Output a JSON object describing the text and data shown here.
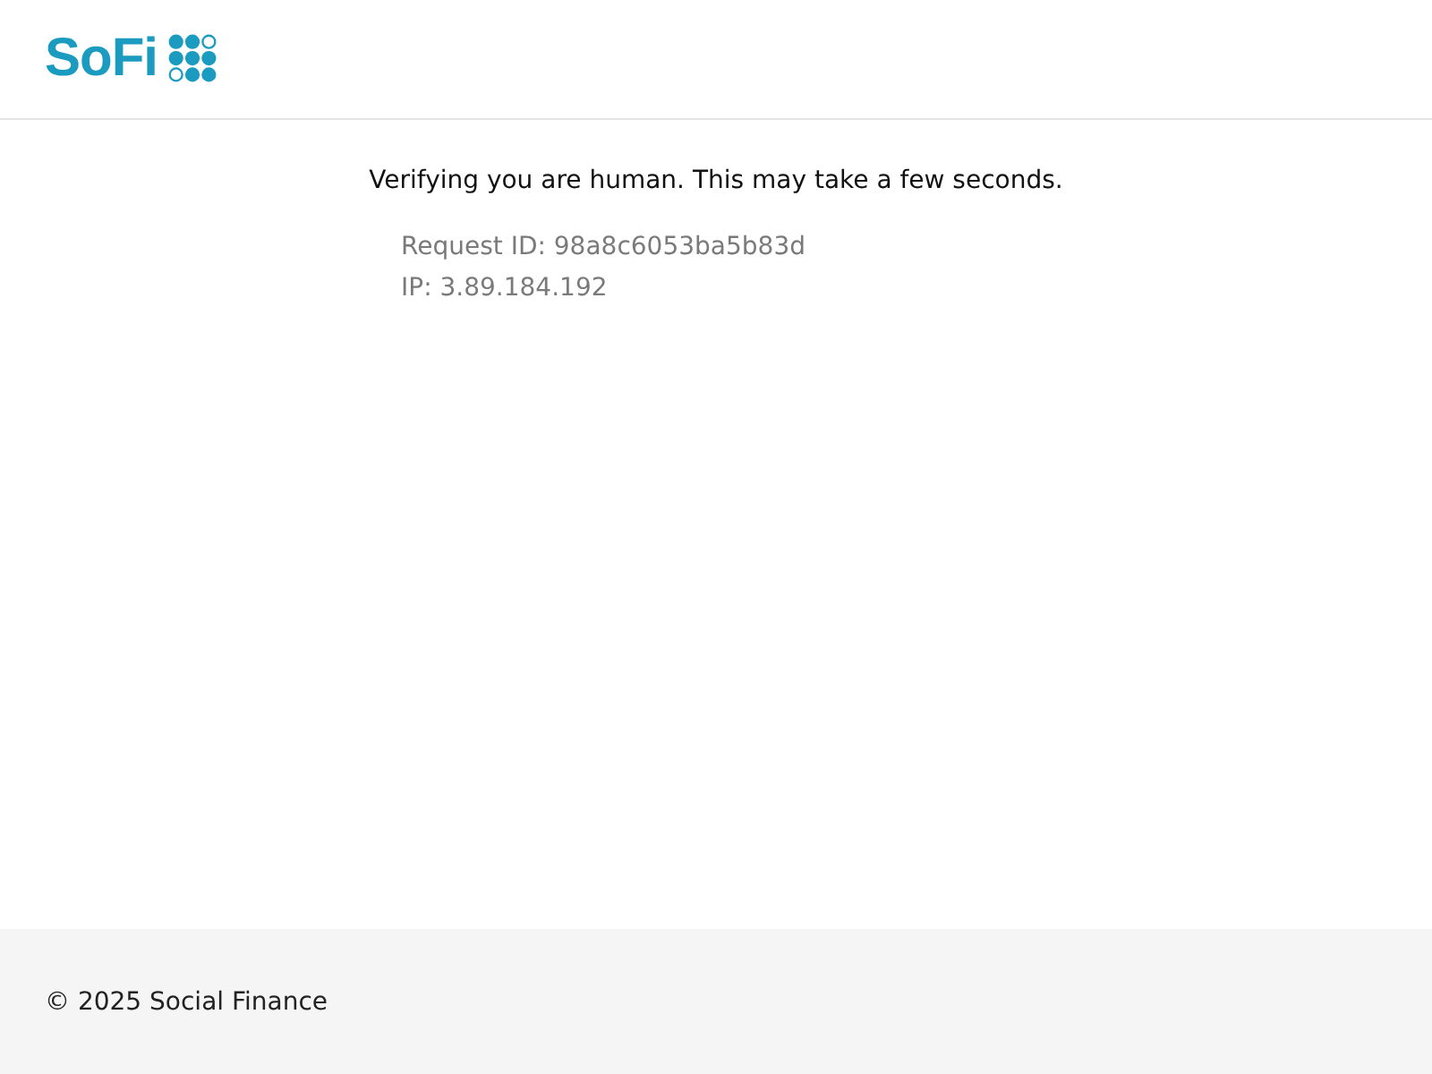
{
  "header": {
    "logo": "SoFi"
  },
  "message": "Verifying you are human. This may take a few seconds.",
  "details": [
    "Request ID: 98a8c6053ba5b83d",
    "IP: 3.89.184.192"
  ],
  "footer": {
    "copyright": "© 2025 Social Finance"
  }
}
